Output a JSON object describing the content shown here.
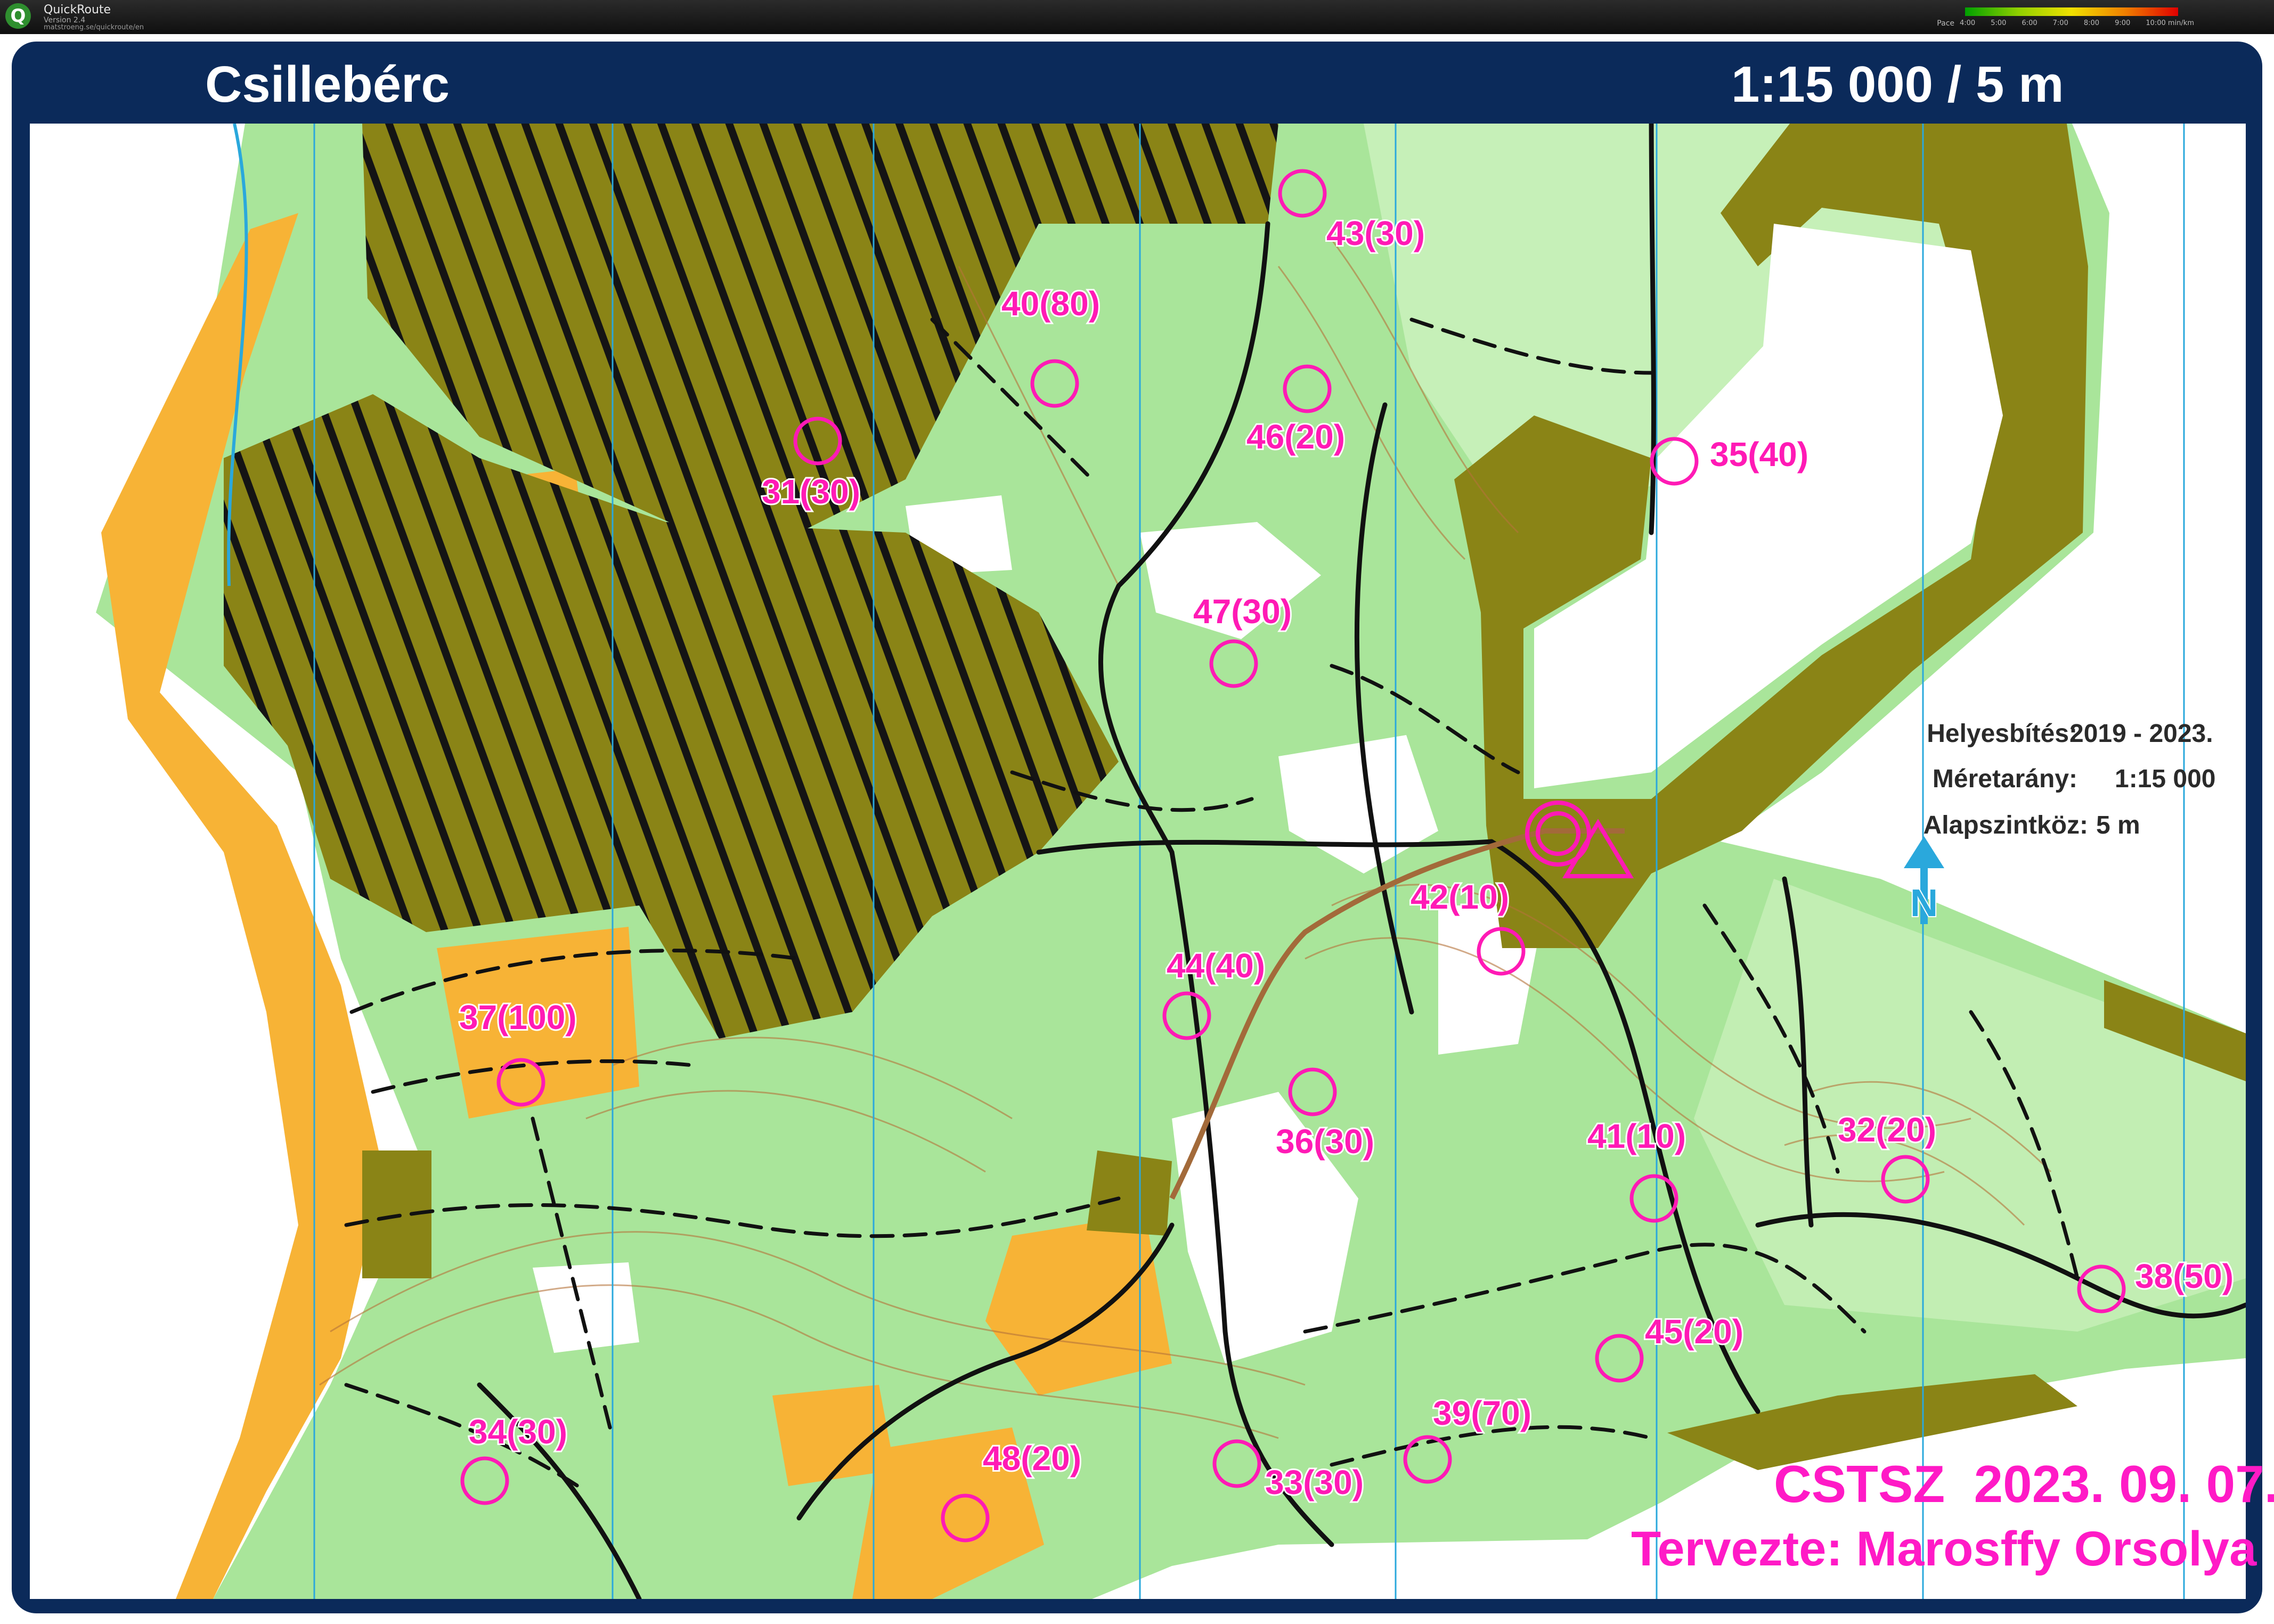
{
  "app": {
    "name": "QuickRoute",
    "version": "Version 2.4",
    "url": "matstroeng.se/quickroute/en",
    "legend_label": "Pace",
    "legend_ticks": [
      "4:00",
      "5:00",
      "6:00",
      "7:00",
      "8:00",
      "9:00",
      "10:00 min/km"
    ]
  },
  "map": {
    "title": "Csillebérc",
    "scale_line": "1:15 000 / 5 m",
    "info": [
      {
        "label": "Helyesbítés:",
        "value": "2019 - 2023."
      },
      {
        "label": "Méretarány:",
        "value": "1:15 000"
      },
      {
        "label": "Alapszintköz:",
        "value": "5 m"
      }
    ],
    "north_symbol": "N",
    "event": "CSTSZ  2023. 09. 07.",
    "designer": "Tervezte: Marosffy Orsolya",
    "colors": {
      "frame": "#0b2a5a",
      "forest_green": "#a9e59a",
      "light_green": "#c6f0b8",
      "dark_olive": "#8a8416",
      "open_yellow": "#f7b336",
      "course_magenta": "#ff1ab5",
      "north_arrow": "#2aa8dc"
    },
    "start_symbol": "start-triangle-icon",
    "finish_symbol": "finish-double-circle-icon",
    "controls": [
      {
        "label": "31(30)"
      },
      {
        "label": "32(20)"
      },
      {
        "label": "33(30)"
      },
      {
        "label": "34(30)"
      },
      {
        "label": "35(40)"
      },
      {
        "label": "36(30)"
      },
      {
        "label": "37(100)"
      },
      {
        "label": "38(50)"
      },
      {
        "label": "39(70)"
      },
      {
        "label": "40(80)"
      },
      {
        "label": "41(10)"
      },
      {
        "label": "42(10)"
      },
      {
        "label": "43(30)"
      },
      {
        "label": "44(40)"
      },
      {
        "label": "45(20)"
      },
      {
        "label": "46(20)"
      },
      {
        "label": "47(30)"
      },
      {
        "label": "48(20)"
      }
    ]
  }
}
